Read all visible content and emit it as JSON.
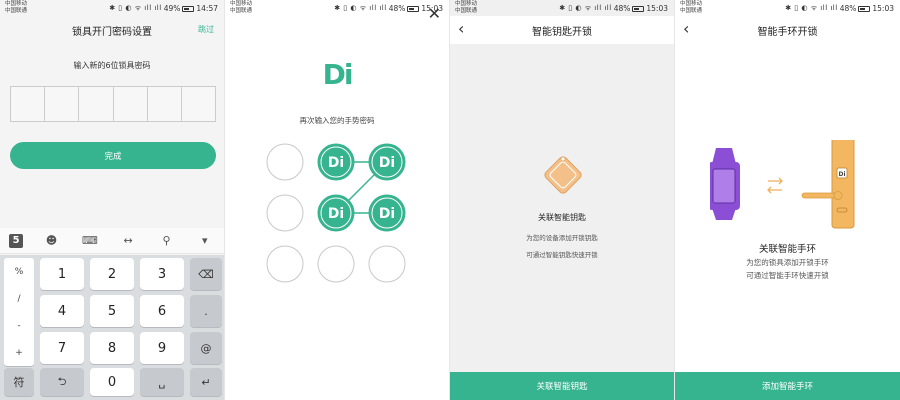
{
  "colors": {
    "accent": "#36b48f",
    "band": "#8b4fd6",
    "lock": "#f2b760",
    "key": "#f4c08a"
  },
  "status": {
    "s1": {
      "carrier1": "中国移动",
      "carrier2": "中国联通",
      "battery": "49%",
      "time": "14:57"
    },
    "s2": {
      "carrier1": "中国移动",
      "carrier2": "中国联通",
      "battery": "48%",
      "time": "15:03"
    },
    "s3": {
      "carrier1": "中国移动",
      "carrier2": "中国联通",
      "battery": "48%",
      "time": "15:03"
    },
    "s4": {
      "carrier1": "中国移动",
      "carrier2": "中国联通",
      "battery": "48%",
      "time": "15:03"
    }
  },
  "screen1": {
    "title": "锁具开门密码设置",
    "skip": "跳过",
    "prompt": "输入新的6位锁具密码",
    "done": "完成",
    "toolbar_icons": [
      "sogou-logo-icon",
      "emoji-icon",
      "keyboard-icon",
      "cursor-move-icon",
      "search-icon",
      "collapse-icon"
    ],
    "symbols": [
      "%",
      "/",
      "-",
      "+"
    ],
    "keys": {
      "k1": "1",
      "k2": "2",
      "k3": "3",
      "k4": "4",
      "k5": "5",
      "k6": "6",
      "k7": "7",
      "k8": "8",
      "k9": "9",
      "k0": "0",
      "dot": ".",
      "at": "@",
      "sym": "符",
      "undo": "⮌",
      "space": "␣",
      "backspace": "⌫",
      "enter": "↵"
    }
  },
  "screen2": {
    "logo": "Di",
    "prompt": "再次输入您的手势密码",
    "pattern_nodes": [
      2,
      3,
      5,
      6
    ]
  },
  "screen3": {
    "title": "智能钥匙开锁",
    "feature_title": "关联智能钥匙",
    "sub1": "为您的设备添加开锁钥匙",
    "sub2": "可通过智能钥匙快速开锁",
    "button": "关联智能钥匙"
  },
  "screen4": {
    "title": "智能手环开锁",
    "feature_title": "关联智能手环",
    "sub1": "为您的锁具添加开锁手环",
    "sub2": "可通过智能手环快速开锁",
    "button": "添加智能手环",
    "lock_label": "Di"
  }
}
